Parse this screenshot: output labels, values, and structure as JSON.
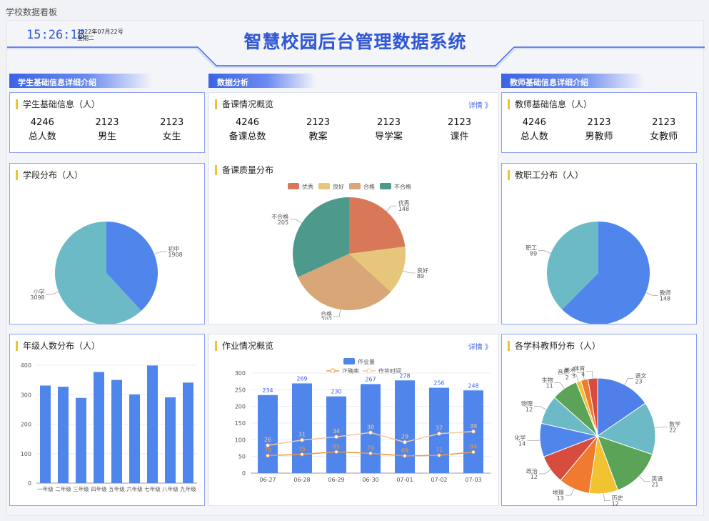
{
  "page_label": "学校数据看板",
  "header": {
    "time": "15:26:18",
    "date": "2022年07月22号",
    "weekday": "星期二",
    "title": "智慧校园后台管理数据系统"
  },
  "sections": {
    "student": "学生基础信息详细介绍",
    "analysis": "数据分析",
    "teacher": "教师基础信息详细介绍"
  },
  "student_info": {
    "title": "学生基础信息（人）",
    "stats": [
      {
        "value": "4246",
        "label": "总人数"
      },
      {
        "value": "2123",
        "label": "男生"
      },
      {
        "value": "2123",
        "label": "女生"
      }
    ]
  },
  "prep_overview": {
    "title": "备课情况概览",
    "more": "详情 》",
    "stats": [
      {
        "value": "4246",
        "label": "备课总数"
      },
      {
        "value": "2123",
        "label": "教案"
      },
      {
        "value": "2123",
        "label": "导学案"
      },
      {
        "value": "2123",
        "label": "课件"
      }
    ]
  },
  "teacher_info": {
    "title": "教师基础信息（人）",
    "stats": [
      {
        "value": "4246",
        "label": "总人数"
      },
      {
        "value": "2123",
        "label": "男教师"
      },
      {
        "value": "2123",
        "label": "女教师"
      }
    ]
  },
  "stage_title": "学段分布（人）",
  "quality_title": "备课质量分布",
  "staff_title": "教职工分布（人）",
  "grade_title": "年级人数分布（人）",
  "homework_title": "作业情况概览",
  "homework_more": "详情 》",
  "subject_title": "各学科教师分布（人）",
  "colors": {
    "accent": "#2f57d6",
    "blue": "#5086ec",
    "teal": "#6bbac5",
    "orange": "#f19a3c"
  },
  "chart_data": [
    {
      "id": "stage",
      "type": "pie",
      "slices": [
        {
          "name": "初中",
          "value": 1908,
          "color": "#5086ec"
        },
        {
          "name": "小学",
          "value": 3098,
          "color": "#6bbac5"
        }
      ]
    },
    {
      "id": "quality",
      "type": "pie",
      "legend": [
        "优秀",
        "良好",
        "合格",
        "不合格"
      ],
      "slices": [
        {
          "name": "优秀",
          "value": 148,
          "color": "#d97858"
        },
        {
          "name": "良好",
          "value": 89,
          "color": "#e6c67a"
        },
        {
          "name": "合格",
          "value": 202,
          "color": "#d9a677"
        },
        {
          "name": "不合格",
          "value": 205,
          "color": "#4d9a8c"
        }
      ]
    },
    {
      "id": "staff",
      "type": "pie",
      "slices": [
        {
          "name": "教师",
          "value": 148,
          "color": "#5086ec"
        },
        {
          "name": "职工",
          "value": 89,
          "color": "#6bbac5"
        }
      ]
    },
    {
      "id": "grade",
      "type": "bar",
      "categories": [
        "一年级",
        "二年级",
        "三年级",
        "四年级",
        "五年级",
        "六年级",
        "七年级",
        "八年级",
        "九年级"
      ],
      "values": [
        331,
        327,
        289,
        377,
        350,
        301,
        399,
        291,
        341
      ],
      "ylim": [
        0,
        400
      ],
      "yticks": [
        0,
        100,
        200,
        300,
        400
      ]
    },
    {
      "id": "homework",
      "type": "bar+line",
      "categories": [
        "06-27",
        "06-28",
        "06-29",
        "06-30",
        "07-01",
        "07-02",
        "07-03"
      ],
      "series": [
        {
          "name": "作业量",
          "type": "bar",
          "values": [
            234,
            269,
            230,
            267,
            278,
            256,
            248
          ],
          "labels": [
            "234",
            "269",
            "230",
            "267",
            "278",
            "256",
            "248"
          ]
        },
        {
          "name": "正确率",
          "type": "line",
          "values": [
            70,
            75,
            85,
            79,
            69,
            71,
            84
          ]
        },
        {
          "name": "作答时间",
          "type": "line",
          "values": [
            26,
            31,
            34,
            38,
            29,
            37,
            39
          ]
        }
      ],
      "ytick_labels": [
        "0",
        "50",
        "100",
        "150",
        "200",
        "250",
        "300"
      ],
      "ylim": [
        0,
        300
      ]
    },
    {
      "id": "subject",
      "type": "pie",
      "slices": [
        {
          "name": "语文",
          "value": 23,
          "color": "#4f7fe8"
        },
        {
          "name": "数学",
          "value": 22,
          "color": "#6bbac5"
        },
        {
          "name": "英语",
          "value": 21,
          "color": "#5aa357"
        },
        {
          "name": "历史",
          "value": 12,
          "color": "#f1c232"
        },
        {
          "name": "地理",
          "value": 13,
          "color": "#f07a2e"
        },
        {
          "name": "政治",
          "value": 12,
          "color": "#d84b3f"
        },
        {
          "name": "化学",
          "value": 14,
          "color": "#5086ec"
        },
        {
          "name": "物理",
          "value": 12,
          "color": "#6bbac5"
        },
        {
          "name": "生物",
          "value": 11,
          "color": "#5aa357"
        },
        {
          "name": "音乐",
          "value": 2,
          "color": "#f1c232"
        },
        {
          "name": "美术",
          "value": 3,
          "color": "#f07a2e"
        },
        {
          "name": "体育",
          "value": 4,
          "color": "#d84b3f"
        }
      ]
    }
  ]
}
